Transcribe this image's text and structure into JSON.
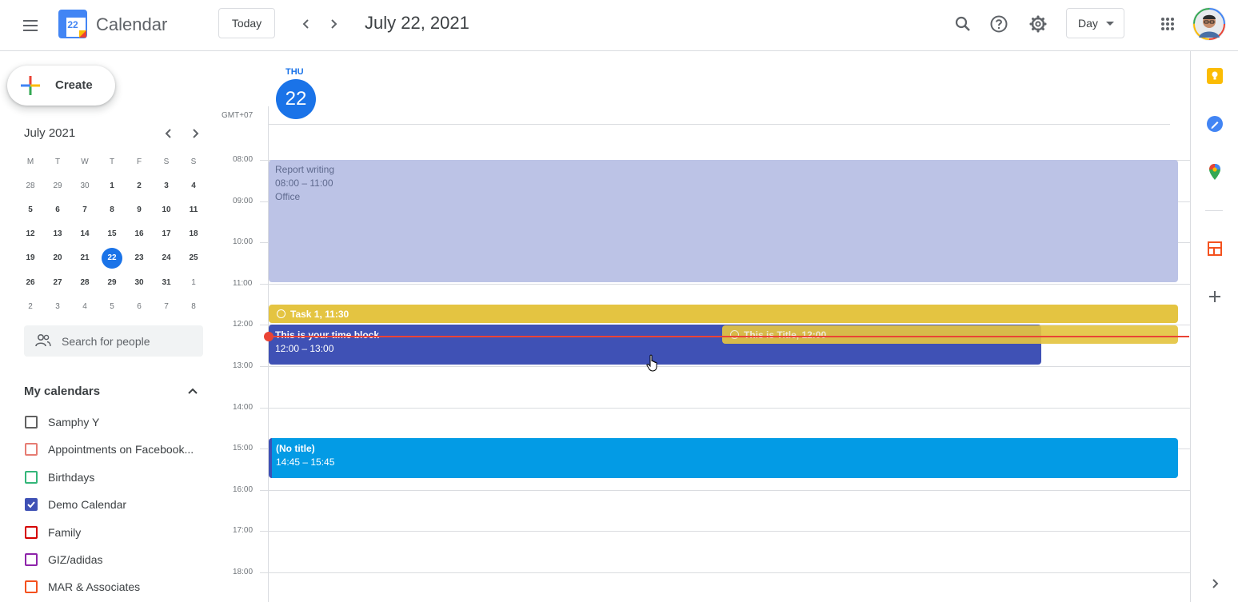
{
  "header": {
    "app_title": "Calendar",
    "logo_day": "22",
    "today_label": "Today",
    "date_title": "July 22, 2021",
    "view_label": "Day"
  },
  "sidebar": {
    "create_label": "Create",
    "mini_calendar": {
      "month_title": "July 2021",
      "day_headers": [
        "M",
        "T",
        "W",
        "T",
        "F",
        "S",
        "S"
      ],
      "weeks": [
        [
          "28",
          "29",
          "30",
          "1",
          "2",
          "3",
          "4"
        ],
        [
          "5",
          "6",
          "7",
          "8",
          "9",
          "10",
          "11"
        ],
        [
          "12",
          "13",
          "14",
          "15",
          "16",
          "17",
          "18"
        ],
        [
          "19",
          "20",
          "21",
          "22",
          "23",
          "24",
          "25"
        ],
        [
          "26",
          "27",
          "28",
          "29",
          "30",
          "31",
          "1"
        ],
        [
          "2",
          "3",
          "4",
          "5",
          "6",
          "7",
          "8"
        ]
      ],
      "selected": "22"
    },
    "search_placeholder": "Search for people",
    "my_calendars_title": "My calendars",
    "calendars": [
      {
        "name": "Samphy Y",
        "color": "#616161",
        "checked": false
      },
      {
        "name": "Appointments on Facebook...",
        "color": "#e67c73",
        "checked": false
      },
      {
        "name": "Birthdays",
        "color": "#33b679",
        "checked": false
      },
      {
        "name": "Demo Calendar",
        "color": "#3f51b5",
        "checked": true
      },
      {
        "name": "Family",
        "color": "#d50000",
        "checked": false
      },
      {
        "name": "GIZ/adidas",
        "color": "#8e24aa",
        "checked": false
      },
      {
        "name": "MAR & Associates",
        "color": "#f4511e",
        "checked": false
      }
    ]
  },
  "day_view": {
    "day_name": "THU",
    "day_number": "22",
    "timezone": "GMT+07",
    "hours": [
      "08:00",
      "09:00",
      "10:00",
      "11:00",
      "12:00",
      "13:00",
      "14:00",
      "15:00",
      "16:00",
      "17:00",
      "18:00"
    ],
    "events": {
      "report": {
        "title": "Report writing",
        "time": "08:00 – 11:00",
        "location": "Office"
      },
      "task1": {
        "label": "Task 1, 11:30"
      },
      "timeblock": {
        "title": "This is your time block",
        "time": "12:00 – 13:00"
      },
      "titletask": {
        "label": "This is Title, 12:00"
      },
      "notitle": {
        "title": "(No title)",
        "time": "14:45 – 15:45"
      }
    }
  },
  "colors": {
    "accent": "#1a73e8",
    "report_bg": "#bcc3e6",
    "task_bg": "#e4c441",
    "timeblock_bg": "#3f51b5",
    "notitle_bg": "#039be5",
    "now_line": "#ea4335"
  },
  "side_panel_icons": [
    "keep-icon",
    "tasks-icon",
    "maps-icon",
    "add-on-icon",
    "add-icon",
    "expand-icon"
  ]
}
